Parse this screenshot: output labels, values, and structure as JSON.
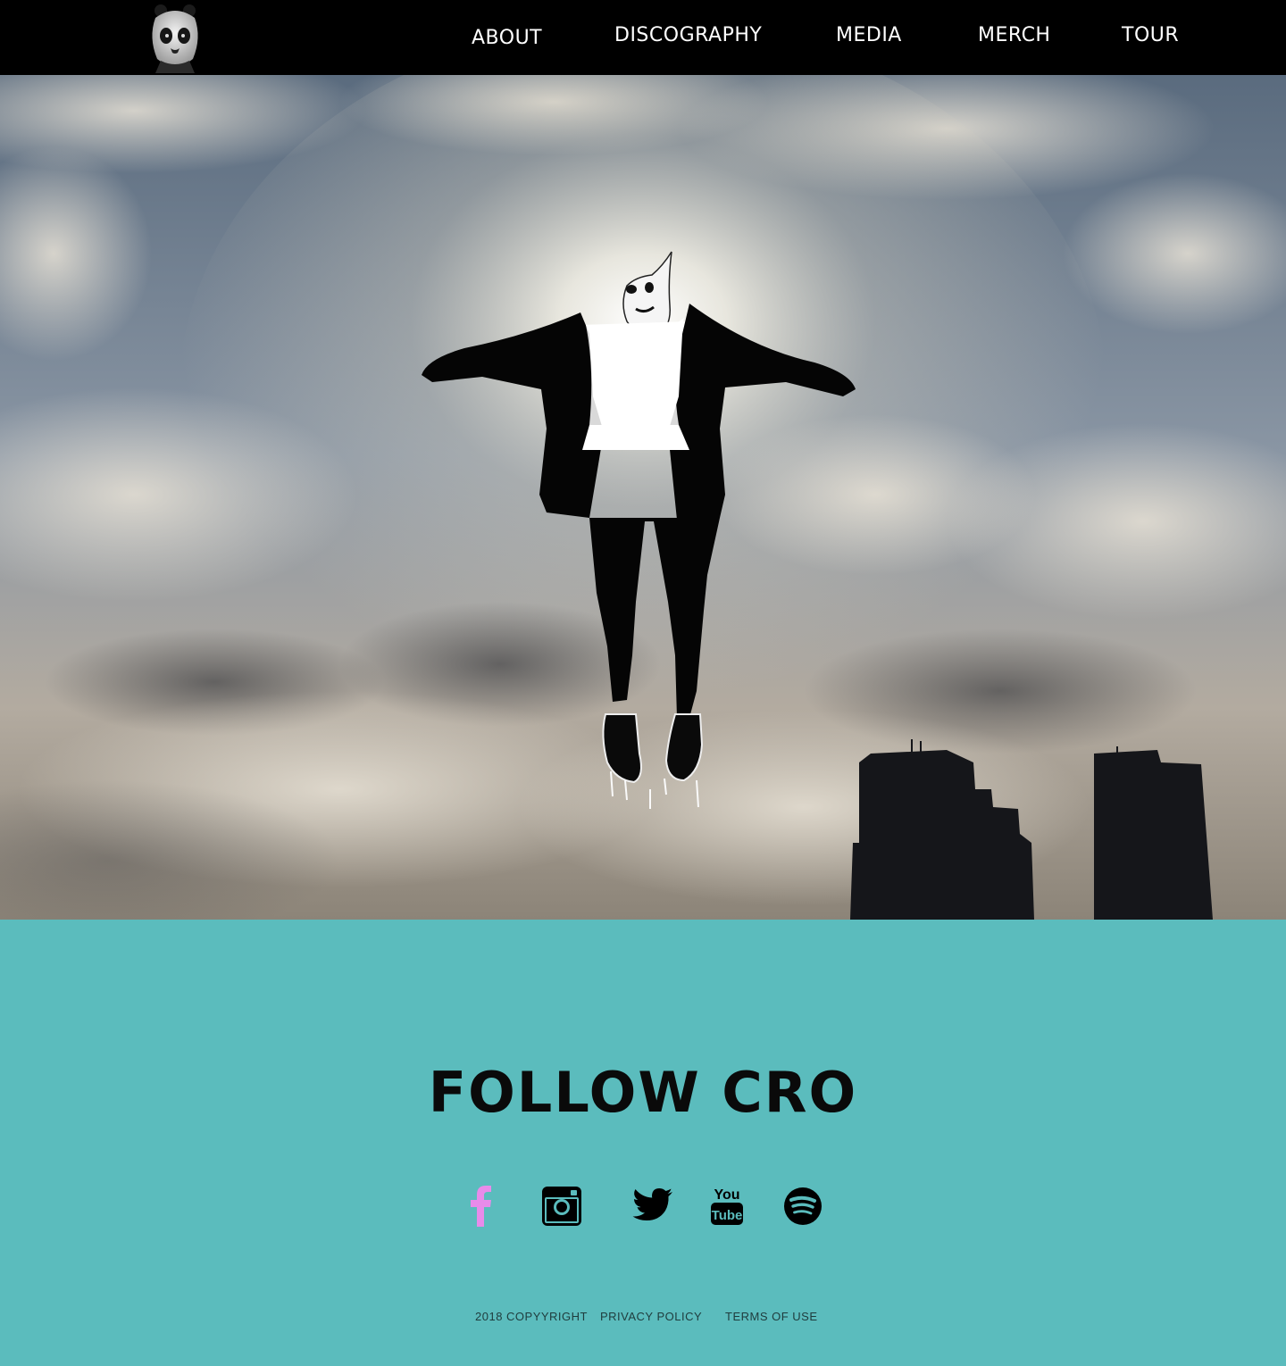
{
  "header": {
    "logo_icon": "panda-mask-logo-icon",
    "nav": [
      {
        "label": "ABOUT"
      },
      {
        "label": "DISCOGRAPHY"
      },
      {
        "label": "MEDIA"
      },
      {
        "label": "MERCH"
      },
      {
        "label": "TOUR"
      }
    ]
  },
  "hero": {
    "image": "floating-figure-in-cloudy-sky-image"
  },
  "follow": {
    "title": "FOLLOW CRO",
    "background_color": "#5bbcbd",
    "social": [
      {
        "icon": "facebook-icon",
        "color": "#e88bea"
      },
      {
        "icon": "instagram-icon",
        "color": "#000000"
      },
      {
        "icon": "twitter-icon",
        "color": "#000000"
      },
      {
        "icon": "youtube-icon",
        "color": "#000000"
      },
      {
        "icon": "spotify-icon",
        "color": "#000000"
      }
    ]
  },
  "footer": {
    "copyright": "2018 COPYYRIGHT",
    "privacy": "PRIVACY POLICY",
    "terms": "TERMS OF USE"
  }
}
